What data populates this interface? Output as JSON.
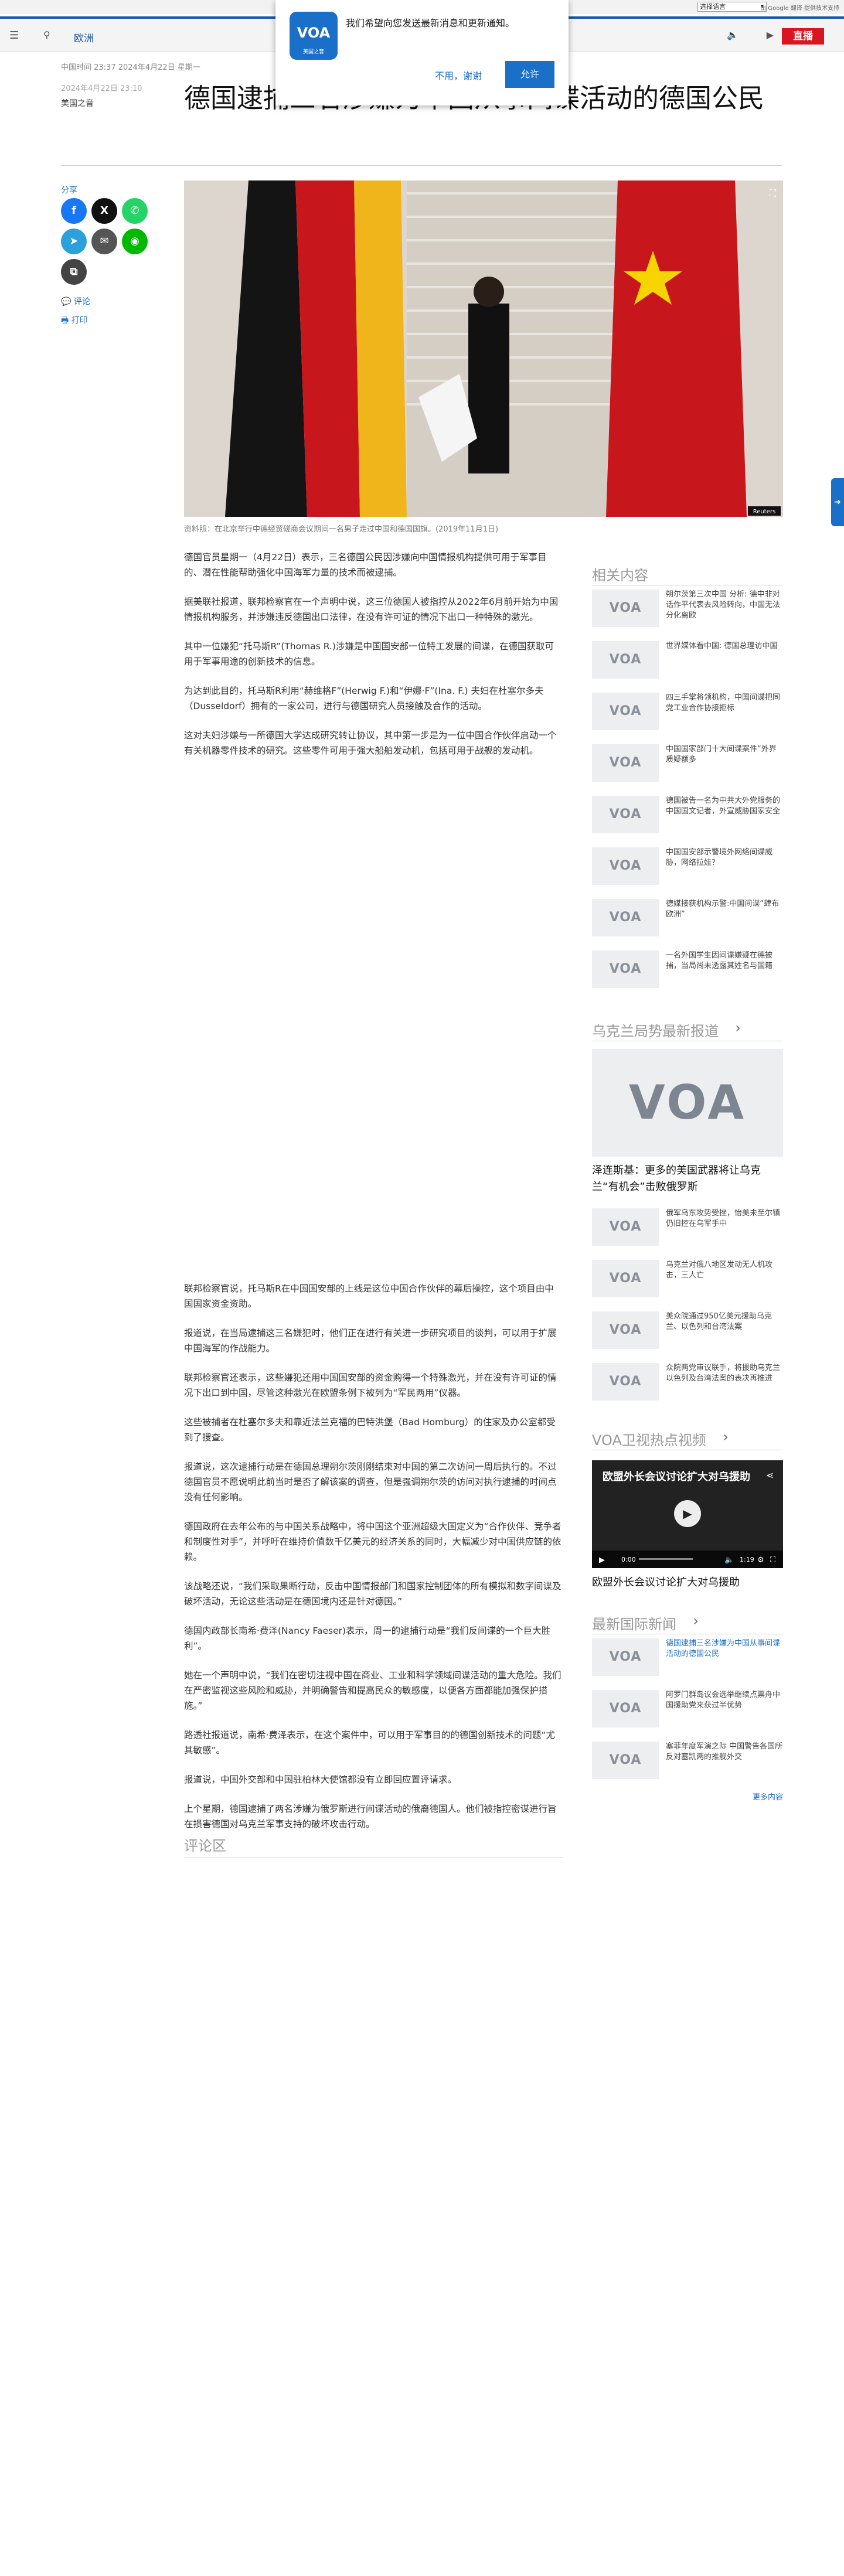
{
  "lang_bar": {
    "select_label": "选择语言",
    "translate_label": "由 Google 翻译 提供技术支持"
  },
  "nav": {
    "section": "欧洲",
    "live_label": "直播"
  },
  "notification": {
    "logo_text": "VOA",
    "logo_sub": "美国之音",
    "message": "我们希望向您发送最新消息和更新通知。",
    "decline": "不用，谢谢",
    "accept": "允许"
  },
  "article": {
    "meta_top": "中国时间 23:37 2024年4月22日 星期一",
    "date": "2024年4月22日 23:10",
    "byline": "美国之音",
    "title": "德国逮捕三名涉嫌为中国从事间谍活动的德国公民",
    "share_label": "分享",
    "comment_link": "评论",
    "print_link": "打印",
    "caption": "资料照：在北京举行中德经贸磋商会议期间一名男子走过中国和德国国旗。(2019年11月1日)",
    "paragraphs_a": [
      "德国官员星期一（4月22日）表示，三名德国公民因涉嫌向中国情报机构提供可用于军事目的、潜在性能帮助强化中国海军力量的技术而被逮捕。",
      "据美联社报道，联邦检察官在一个声明中说，这三位德国人被指控从2022年6月前开始为中国情报机构服务，并涉嫌违反德国出口法律，在没有许可证的情况下出口一种特殊的激光。",
      "其中一位嫌犯“托马斯R”(Thomas R.)涉嫌是中国国安部一位特工发展的间谍，在德国获取可用于军事用途的创新技术的信息。",
      "为达到此目的，托马斯R利用“赫维格F”(Herwig F.)和“伊娜·F”(Ina. F.) 夫妇在杜塞尔多夫（Dusseldorf）拥有的一家公司，进行与德国研究人员接触及合作的活动。",
      "这对夫妇涉嫌与一所德国大学达成研究转让协议，其中第一步是为一位中国合作伙伴启动一个有关机器零件技术的研究。这些零件可用于强大船舶发动机，包括可用于战舰的发动机。"
    ],
    "paragraphs_b": [
      "联邦检察官说，托马斯R在中国国安部的上线是这位中国合作伙伴的幕后操控，这个项目由中国国家资金资助。",
      "报道说，在当局逮捕这三名嫌犯时，他们正在进行有关进一步研究项目的谈判，可以用于扩展中国海军的作战能力。",
      "联邦检察官还表示，这些嫌犯还用中国国安部的资金购得一个特殊激光，并在没有许可证的情况下出口到中国，尽管这种激光在欧盟条例下被列为“军民两用”仪器。",
      "这些被捕者在杜塞尔多夫和靠近法兰克福的巴特洪堡（Bad Homburg）的住家及办公室都受到了搜查。",
      "报道说，这次逮捕行动是在德国总理朔尔茨刚刚结束对中国的第二次访问一周后执行的。不过德国官员不愿说明此前当时是否了解该案的调查，但是强调朔尔茨的访问对执行逮捕的时间点没有任何影响。",
      "德国政府在去年公布的与中国关系战略中，将中国这个亚洲超级大国定义为“合作伙伴、竞争者和制度性对手”，并呼吁在维持价值数千亿美元的经济关系的同时，大幅减少对中国供应链的依赖。",
      "该战略还说，“我们采取果断行动，反击中国情报部门和国家控制团体的所有模拟和数字间谍及破坏活动，无论这些活动是在德国境内还是针对德国。”",
      "德国内政部长南希·费泽(Nancy Faeser)表示，周一的逮捕行动是“我们反间谍的一个巨大胜利”。",
      "她在一个声明中说，“我们在密切注视中国在商业、工业和科学领域间谍活动的重大危险。我们在严密监视这些风险和威胁，并明确警告和提高民众的敏感度，以便各方面都能加强保护措施。”",
      "路透社报道说，南希·费泽表示，在这个案件中，可以用于军事目的的德国创新技术的问题“尤其敏感”。",
      "报道说，中国外交部和中国驻柏林大使馆都没有立即回应置评请求。",
      "上个星期，德国逮捕了两名涉嫌为俄罗斯进行间谍活动的俄裔德国人。他们被指控密谋进行旨在损害德国对乌克兰军事支持的破坏攻击行动。"
    ],
    "comments_heading": "评论区"
  },
  "rail": {
    "related_heading": "相关内容",
    "thumb_text": "VOA",
    "related": [
      "朔尔茨第三次中国 分析: 德中非对话作平代表去风险转向，中国无法分化离欧",
      "世界媒体看中国: 德国总理访中国",
      "四三手掌将领机构，中国间谍把同党工业合作协接拒标",
      "中国国家部门十大间谍案件“外界质疑额多",
      "德国被告一名为中共大外党服务的中国国文记者，外宣威胁国家安全",
      "中国国安部示警境外网络间谍威胁，网络拉娃？",
      "德媒接获机构示警:中国间谍“肆布欧洲”",
      "一名外国学生因间谍嫌疑在德被捕，当局尚未透露其姓名与国籍"
    ],
    "ukraine_heading": "乌克兰局势最新报道",
    "ukraine_main_title": "泽连斯基：更多的美国武器将让乌克兰“有机会”击败俄罗斯",
    "ukraine_items": [
      "俄军乌东攻势受挫，怡美未至尔镇仍旧控在乌军手中",
      "乌克兰对俄八地区发动无人机攻击，三人亡",
      "美众院通过950亿美元援助乌克兰、以色列和台湾法案",
      "众院两党审议联手，将援助乌克兰以色列及台湾法案的表决再推进"
    ],
    "video_heading": "VOA卫视热点视频",
    "video_title": "欧盟外长会议讨论扩大对乌援助",
    "video_time": "0:00",
    "video_duration": "1:19",
    "video_caption": "欧盟外长会议讨论扩大对乌援助",
    "intl_heading": "最新国际新闻",
    "intl_items": [
      "德国逮捕三名涉嫌为中国从事间谍活动的德国公民",
      "阿罗门群岛议会选举继续点票舟中国援助党来获过半优势",
      "塞菲年度军演之际 中国警告各国所反对塞凯两的推舰外交"
    ],
    "more_label": "更多内容"
  },
  "colors": {
    "accent": "#1a6fc9",
    "live": "#d7161f",
    "nav_border": "#1457a5"
  },
  "icons": [
    "menu-icon",
    "search-icon",
    "audio-icon",
    "video-icon",
    "facebook-icon",
    "x-icon",
    "whatsapp-icon",
    "telegram-icon",
    "email-icon",
    "line-icon",
    "copy-icon",
    "comment-icon",
    "print-icon",
    "expand-icon",
    "chevron-right-icon",
    "play-icon"
  ]
}
